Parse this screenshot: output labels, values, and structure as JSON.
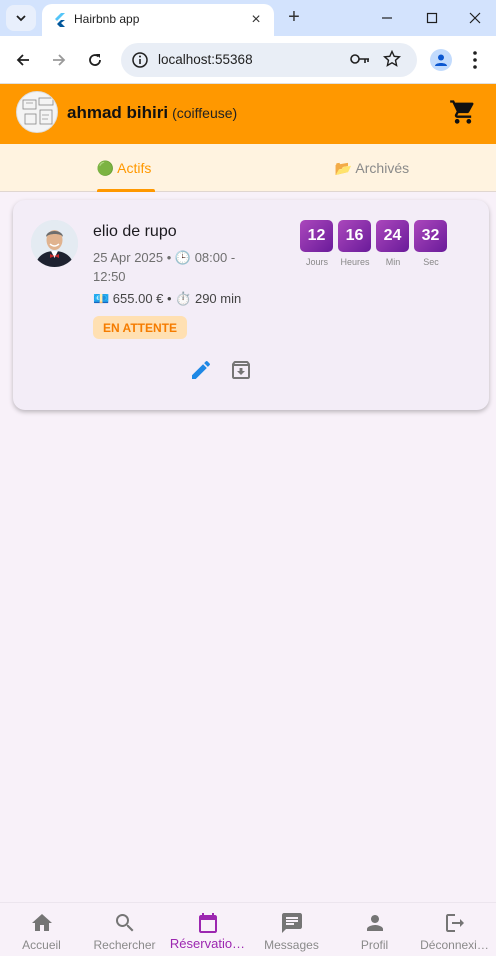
{
  "browser": {
    "tab_title": "Hairbnb app",
    "url": "localhost:55368"
  },
  "appbar": {
    "user_name": "ahmad bihiri",
    "user_role": "(coiffeuse)"
  },
  "tabs": [
    {
      "label": "🟢 Actifs",
      "active": true
    },
    {
      "label": "📂 Archivés",
      "active": false
    }
  ],
  "booking": {
    "client_name": "elio de rupo",
    "when": "25 Apr 2025 • 🕒 08:00 - 12:50",
    "price_line": "💶 655.00 € • ⏱️ 290 min",
    "status": "EN ATTENTE",
    "countdown": [
      {
        "value": "12",
        "label": "Jours"
      },
      {
        "value": "16",
        "label": "Heures"
      },
      {
        "value": "24",
        "label": "Min"
      },
      {
        "value": "32",
        "label": "Sec"
      }
    ]
  },
  "bottom_nav": [
    {
      "label": "Accueil",
      "icon": "home-icon"
    },
    {
      "label": "Rechercher",
      "icon": "search-icon"
    },
    {
      "label": "Réservatio…",
      "icon": "calendar-icon",
      "active": true
    },
    {
      "label": "Messages",
      "icon": "message-icon"
    },
    {
      "label": "Profil",
      "icon": "person-icon"
    },
    {
      "label": "Déconnexi…",
      "icon": "logout-icon"
    }
  ],
  "colors": {
    "primary": "#ff9800",
    "accent": "#9c27b0",
    "tab_bg": "#fff3e0",
    "status_bg": "#ffe0b2"
  }
}
